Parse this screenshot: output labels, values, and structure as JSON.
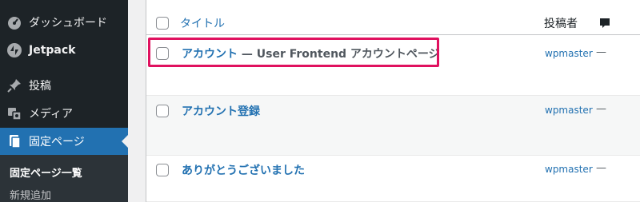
{
  "sidebar": {
    "items": [
      {
        "label": "ダッシュボード",
        "icon": "dashboard-icon"
      },
      {
        "label": "Jetpack",
        "icon": "jetpack-icon"
      },
      {
        "label": "投稿",
        "icon": "pin-icon"
      },
      {
        "label": "メディア",
        "icon": "media-icon"
      },
      {
        "label": "固定ページ",
        "icon": "pages-icon",
        "active": true
      }
    ],
    "submenu": [
      {
        "label": "固定ページ一覧",
        "current": true
      },
      {
        "label": "新規追加"
      }
    ]
  },
  "table": {
    "header": {
      "title": "タイトル",
      "author": "投稿者",
      "comments_icon": "comment-bubble-icon"
    },
    "rows": [
      {
        "title": "アカウント",
        "state": " — User Frontend アカウントページ",
        "author": "wpmaster",
        "comments": "—",
        "highlighted": true
      },
      {
        "title": "アカウント登録",
        "state": "",
        "author": "wpmaster",
        "comments": "—"
      },
      {
        "title": "ありがとうございました",
        "state": "",
        "author": "wpmaster",
        "comments": "—"
      }
    ]
  },
  "colors": {
    "sidebar_bg": "#1d2327",
    "active_bg": "#2271b1",
    "link": "#2271b1",
    "highlight_border": "#e0115f"
  }
}
